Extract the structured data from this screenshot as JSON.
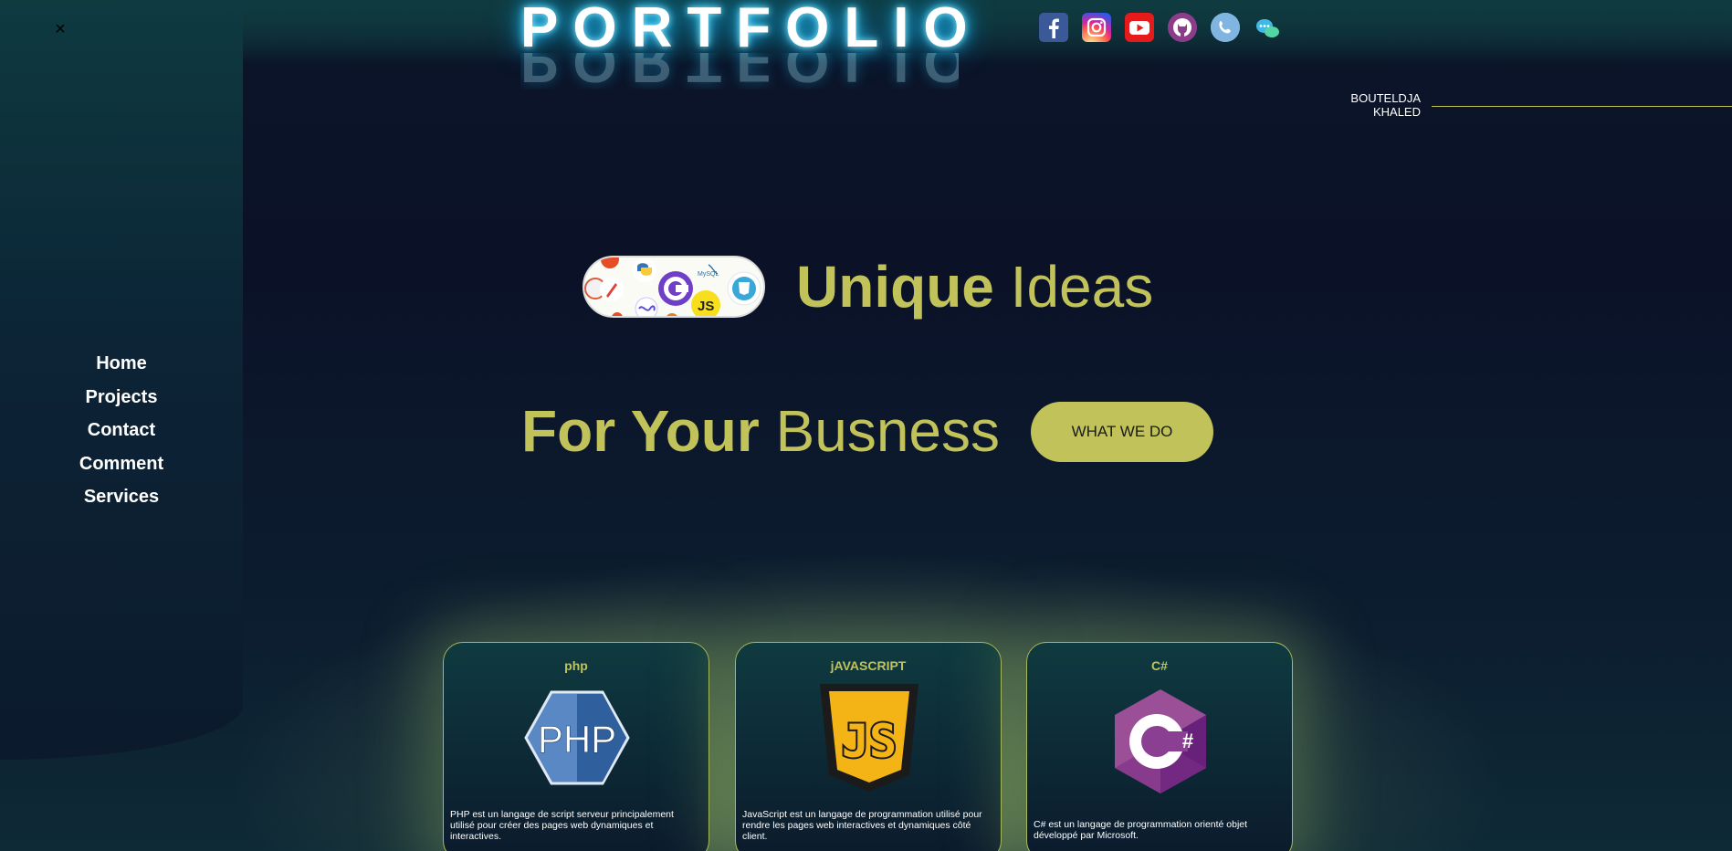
{
  "sidebar": {
    "close_label": "×",
    "items": [
      {
        "label": "Home"
      },
      {
        "label": "Projects"
      },
      {
        "label": "Contact"
      },
      {
        "label": "Comment"
      },
      {
        "label": "Services"
      }
    ]
  },
  "header": {
    "logo": "PORTFOLIO",
    "socials": [
      {
        "name": "facebook-icon",
        "glyph": "f"
      },
      {
        "name": "instagram-icon",
        "glyph": "◎"
      },
      {
        "name": "youtube-icon",
        "glyph": "▶"
      },
      {
        "name": "github-icon",
        "glyph": "●"
      },
      {
        "name": "phone-icon",
        "glyph": "✆"
      },
      {
        "name": "chat-icon",
        "glyph": "💬"
      }
    ],
    "author_first": "BOUTELDJA",
    "author_last": "KHALED"
  },
  "hero": {
    "line1_bold": "Unique",
    "line1_light": "Ideas",
    "line2_bold": "For Your",
    "line2_light": "Busness",
    "cta_label": "WHAT WE DO"
  },
  "cards": [
    {
      "title": "php",
      "logo_text": "PHP",
      "description": "PHP est un langage de script serveur principalement utilisé pour créer des pages web dynamiques et interactives."
    },
    {
      "title": "jAVASCRIPT",
      "logo_text": "JS",
      "description": "JavaScript est un langage de programmation utilisé pour rendre les pages web interactives et dynamiques côté client."
    },
    {
      "title": "C#",
      "logo_text": "C#",
      "description": "C# est un langage de programmation orienté objet développé par Microsoft."
    }
  ],
  "colors": {
    "accent": "#c1c35a",
    "background": "#0b1228",
    "sidebar": "#0e3a40",
    "logo_glow": "#27c8ff"
  }
}
